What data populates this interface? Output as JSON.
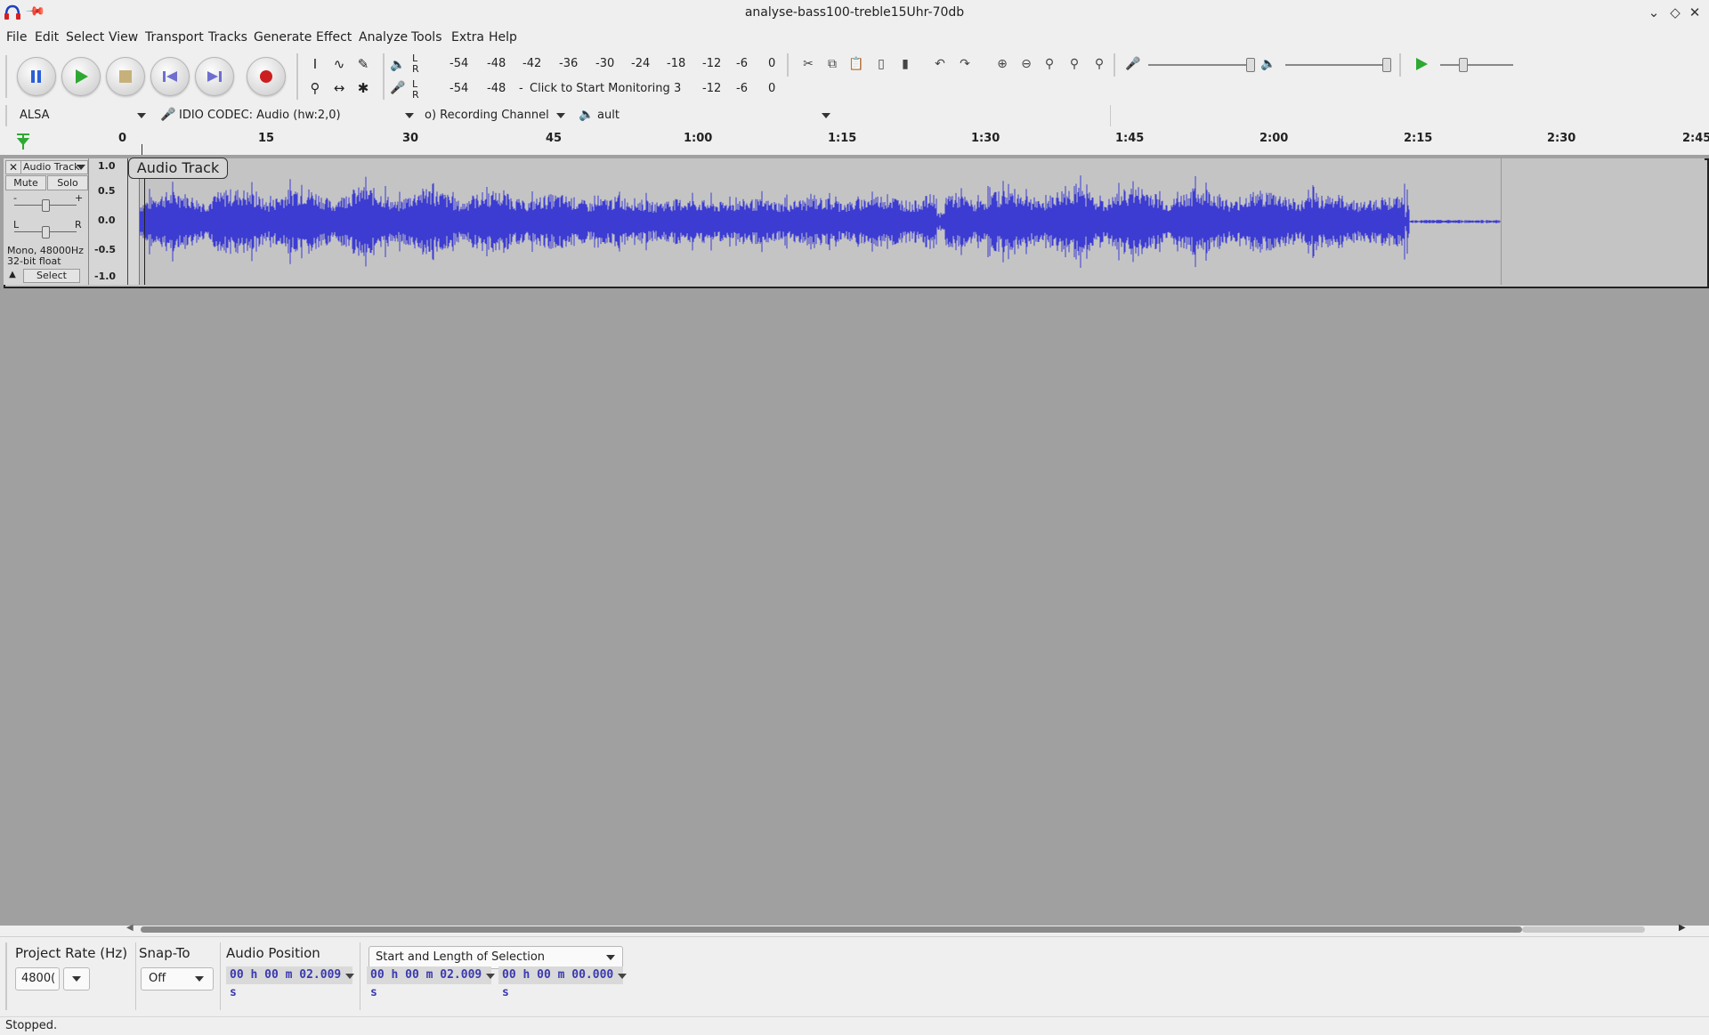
{
  "window": {
    "title": "analyse-bass100-treble15Uhr-70db"
  },
  "menu": [
    "File",
    "Edit",
    "Select",
    "View",
    "Transport",
    "Tracks",
    "Generate",
    "Effect",
    "Analyze",
    "Tools",
    "Extra",
    "Help"
  ],
  "meters": {
    "record_ticks": [
      "-54",
      "-48",
      "-42",
      "-36",
      "-30",
      "-24",
      "-18",
      "-12",
      "-6",
      "0"
    ],
    "playback_ticks_left": [
      "-54",
      "-48"
    ],
    "playback_ticks_right": [
      "-12",
      "-6",
      "0"
    ],
    "monitor_prompt": "Click to Start Monitoring",
    "monitor_suffix": "3",
    "l": "L",
    "r": "R"
  },
  "device": {
    "host": "ALSA",
    "input_device": "IDIO  CODEC: Audio (hw:2,0)",
    "channels": "o) Recording Channel",
    "output_device": "ault"
  },
  "ruler": {
    "ticks": [
      "0",
      "15",
      "30",
      "45",
      "1:00",
      "1:15",
      "1:30",
      "1:45",
      "2:00",
      "2:15",
      "2:30",
      "2:45"
    ]
  },
  "track": {
    "name": "Audio Track",
    "label": "Audio Track",
    "mute": "Mute",
    "solo": "Solo",
    "gain_minus": "-",
    "gain_plus": "+",
    "pan_left": "L",
    "pan_right": "R",
    "format_line1": "Mono, 48000Hz",
    "format_line2": "32-bit float",
    "select": "Select",
    "scale": [
      "1.0",
      "0.5",
      "0.0",
      "-0.5",
      "-1.0"
    ]
  },
  "selection_toolbar": {
    "project_rate_label": "Project Rate (Hz)",
    "project_rate_value": "4800(",
    "snap_to_label": "Snap-To",
    "snap_to_value": "Off",
    "audio_position_label": "Audio Position",
    "audio_position_value": "00 h 00 m 02.009 s",
    "selection_mode": "Start and Length of Selection",
    "selection_start": "00 h 00 m 02.009 s",
    "selection_length": "00 h 00 m 00.000 s"
  },
  "status": {
    "text": "Stopped."
  },
  "colors": {
    "waveform": "#3c3cd2",
    "track_bg": "#c4c4c4",
    "area_bg": "#a0a0a0",
    "time_text": "#3a3ab0",
    "play_green": "#2fa833",
    "record_red": "#cc1f1f"
  }
}
